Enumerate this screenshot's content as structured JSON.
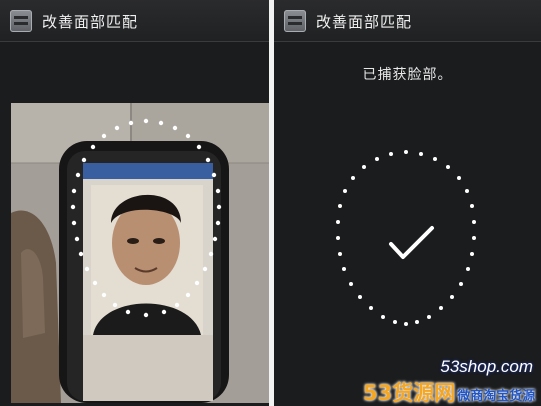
{
  "left_panel": {
    "title": "改善面部匹配",
    "app_icon": "settings-list-icon"
  },
  "right_panel": {
    "title": "改善面部匹配",
    "app_icon": "settings-list-icon",
    "status": "已捕获脸部。",
    "status_icon": "checkmark-icon"
  },
  "watermark": {
    "site": "53shop.com",
    "brand_primary": "53货源网",
    "brand_secondary": "微商淘宝货源"
  },
  "colors": {
    "titlebar": "#252628",
    "panel": "#1b1c1e",
    "dots": "#ffffff",
    "watermark_orange": "#f5a623",
    "watermark_blue": "#2255c4"
  }
}
